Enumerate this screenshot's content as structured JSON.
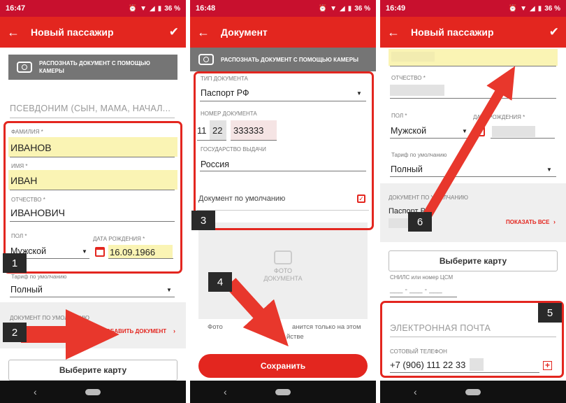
{
  "status": {
    "p1_time": "16:47",
    "p2_time": "16:48",
    "p3_time": "16:49",
    "battery": "36 %"
  },
  "screen1": {
    "title": "Новый пассажир",
    "camera_button": "Распознать документ с помощью камеры",
    "alias_placeholder": "Псевдоним (сын, мама, начал...",
    "lastname_label": "Фамилия *",
    "lastname_value": "ИВАНОВ",
    "firstname_label": "Имя *",
    "firstname_value": "ИВАН",
    "patronymic_label": "Отчество *",
    "patronymic_value": "ИВАНОВИЧ",
    "gender_label": "Пол *",
    "gender_value": "Мужской",
    "birthdate_label": "Дата рождения *",
    "birthdate_value": "16.09.1966",
    "tariff_label": "Тариф по умолчанию",
    "tariff_value": "Полный",
    "document_label": "Документ по умолчанию",
    "add_document": "Добавить документ",
    "choose_card": "Выберите карту"
  },
  "screen2": {
    "title": "Документ",
    "camera_button": "Распознать документ с помощью камеры",
    "doc_type_label": "Тип документа",
    "doc_type_value": "Паспорт РФ",
    "doc_number_label": "Номер документа",
    "doc_number_part1": "11",
    "doc_number_part2": "22",
    "doc_number_part3": "333333",
    "country_label": "Государство выдачи",
    "country_value": "Россия",
    "default_doc": "Документ по умолчанию",
    "photo_label": "Фото документа",
    "photo_note_1": "Фото",
    "photo_note_2": "анится только на этом",
    "photo_note_3": "йстве",
    "save": "Сохранить"
  },
  "screen3": {
    "title": "Новый пассажир",
    "patronymic_label": "Отчество *",
    "gender_label": "Пол *",
    "gender_value": "Мужской",
    "birthdate_label": "Дата рождения *",
    "tariff_label": "Тариф по умолчанию",
    "tariff_value": "Полный",
    "document_label": "Документ по умолчанию",
    "document_value": "Паспорт РФ",
    "show_all": "Показать все",
    "choose_card": "Выберите карту",
    "snils_label": "СНИЛС или номер ЦСМ",
    "snils_value": "___ - ___ - ___",
    "email_placeholder": "Электронная почта",
    "phone_label": "Сотовый телефон",
    "phone_value": "+7 (906) 111 22 33"
  },
  "badges": [
    "1",
    "2",
    "3",
    "4",
    "5",
    "6"
  ],
  "colors": {
    "primary_red": "#e3261f",
    "status_red": "#c8102e",
    "highlight": "#faf4b4",
    "annotation_red": "#e8372c"
  }
}
